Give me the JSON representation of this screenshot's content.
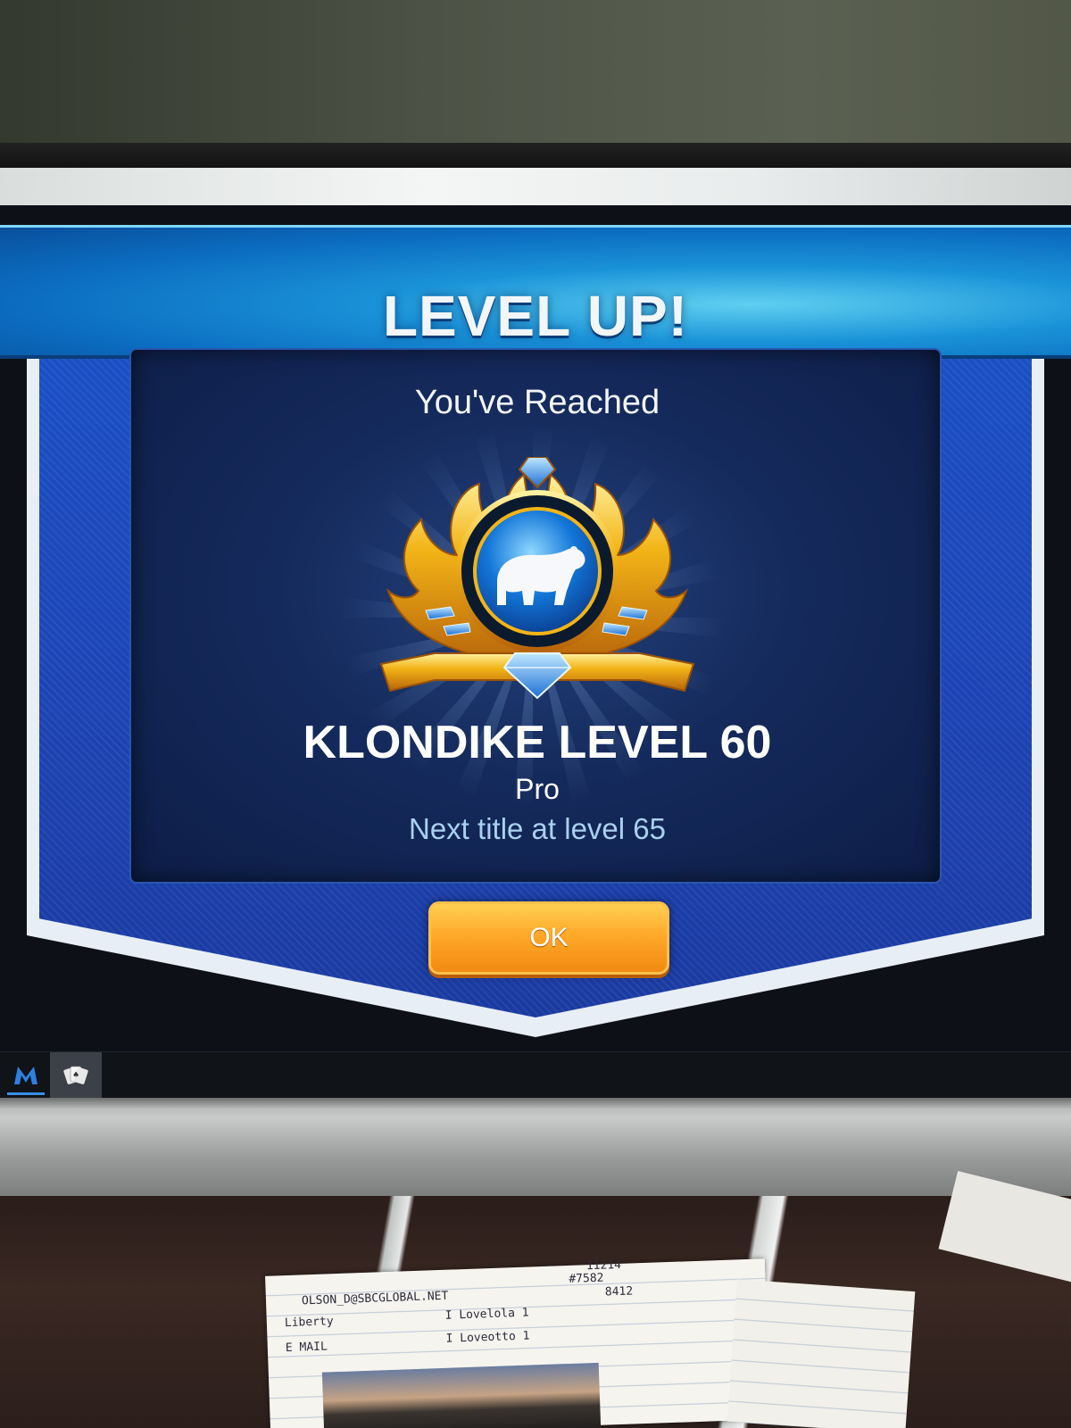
{
  "dialog": {
    "banner_title": "LEVEL UP!",
    "subtitle": "You've Reached",
    "level_title": "KLONDIKE LEVEL 60",
    "rank": "Pro",
    "next_title": "Next title at level 65",
    "ok_label": "OK"
  },
  "badge": {
    "emblem": "polar-bear",
    "colors": {
      "gold": "#f2b417",
      "blue": "#1376d8",
      "gem": "#2a8ef0"
    }
  },
  "taskbar": {
    "items": [
      {
        "name": "malwarebytes-taskbar-icon",
        "active": false
      },
      {
        "name": "solitaire-taskbar-icon",
        "active": true
      }
    ]
  },
  "desk_notes": {
    "line1": "OLSON_D@SBCGLOBAL.NET",
    "line2": "Liberty",
    "line3": "I Lovelola 1",
    "line4": "E MAIL",
    "line5": "I Loveotto 1",
    "line6": "#7582",
    "line7": "8412",
    "line8": "11214"
  },
  "colors": {
    "banner": "#0b6bbf",
    "panel": "#152a5c",
    "button": "#ffa92a",
    "accent_text": "#a9d1ef"
  }
}
